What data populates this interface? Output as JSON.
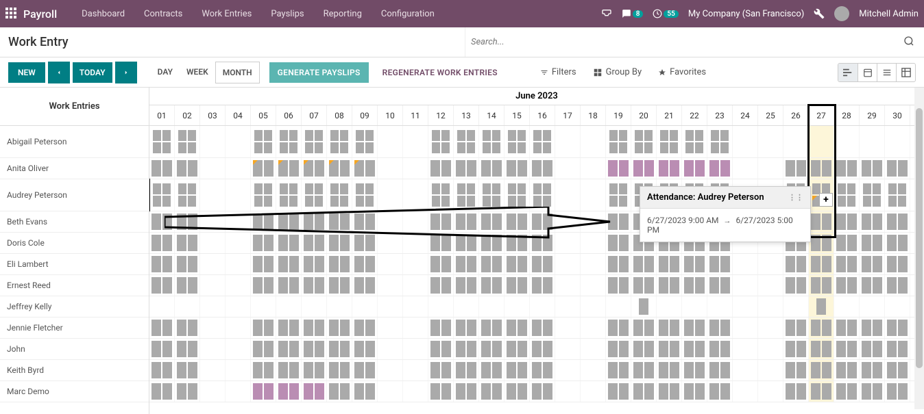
{
  "navbar": {
    "brand": "Payroll",
    "links": [
      "Dashboard",
      "Contracts",
      "Work Entries",
      "Payslips",
      "Reporting",
      "Configuration"
    ],
    "chat_badge": "8",
    "activity_badge": "55",
    "company": "My Company (San Francisco)",
    "user": "Mitchell Admin"
  },
  "page_title": "Work Entry",
  "search_placeholder": "Search...",
  "toolbar": {
    "new": "NEW",
    "today": "TODAY",
    "modes": {
      "day": "DAY",
      "week": "WEEK",
      "month": "MONTH"
    },
    "generate": "GENERATE PAYSLIPS",
    "regenerate": "REGENERATE WORK ENTRIES",
    "filters": "Filters",
    "groupby": "Group By",
    "favorites": "Favorites"
  },
  "gantt": {
    "left_header": "Work Entries",
    "month_label": "June 2023",
    "days": [
      "01",
      "02",
      "03",
      "04",
      "05",
      "06",
      "07",
      "08",
      "09",
      "10",
      "11",
      "12",
      "13",
      "14",
      "15",
      "16",
      "17",
      "18",
      "19",
      "20",
      "21",
      "22",
      "23",
      "24",
      "25",
      "26",
      "27",
      "28",
      "29",
      "30"
    ],
    "weekends": [
      3,
      4,
      10,
      11,
      17,
      18,
      24,
      25
    ],
    "highlight_day": "27",
    "employees": [
      {
        "name": "Abigail Peterson",
        "tall": true,
        "blank_cols": [
          3,
          4,
          10,
          17,
          18,
          24,
          25,
          26,
          27,
          28,
          29,
          30
        ]
      },
      {
        "name": "Anita Oliver",
        "purple_cols": [
          19,
          20,
          21,
          22,
          23
        ],
        "corner_cols": [
          5,
          6,
          7,
          8,
          9
        ]
      },
      {
        "name": "Audrey Peterson",
        "tall": true,
        "corner_cols": [
          27
        ]
      },
      {
        "name": "Beth Evans"
      },
      {
        "name": "Doris Cole"
      },
      {
        "name": "Eli Lambert"
      },
      {
        "name": "Ernest Reed"
      },
      {
        "name": "Jeffrey Kelly",
        "sparse": [
          20,
          27
        ]
      },
      {
        "name": "Jennie Fletcher"
      },
      {
        "name": "John"
      },
      {
        "name": "Keith Byrd"
      },
      {
        "name": "Marc Demo",
        "tall": false,
        "purple_cols": [
          5,
          6,
          7
        ]
      }
    ]
  },
  "tooltip": {
    "title": "Attendance: Audrey Peterson",
    "from": "6/27/2023 9:00 AM",
    "to": "6/27/2023 5:00 PM"
  },
  "plus_label": "+"
}
